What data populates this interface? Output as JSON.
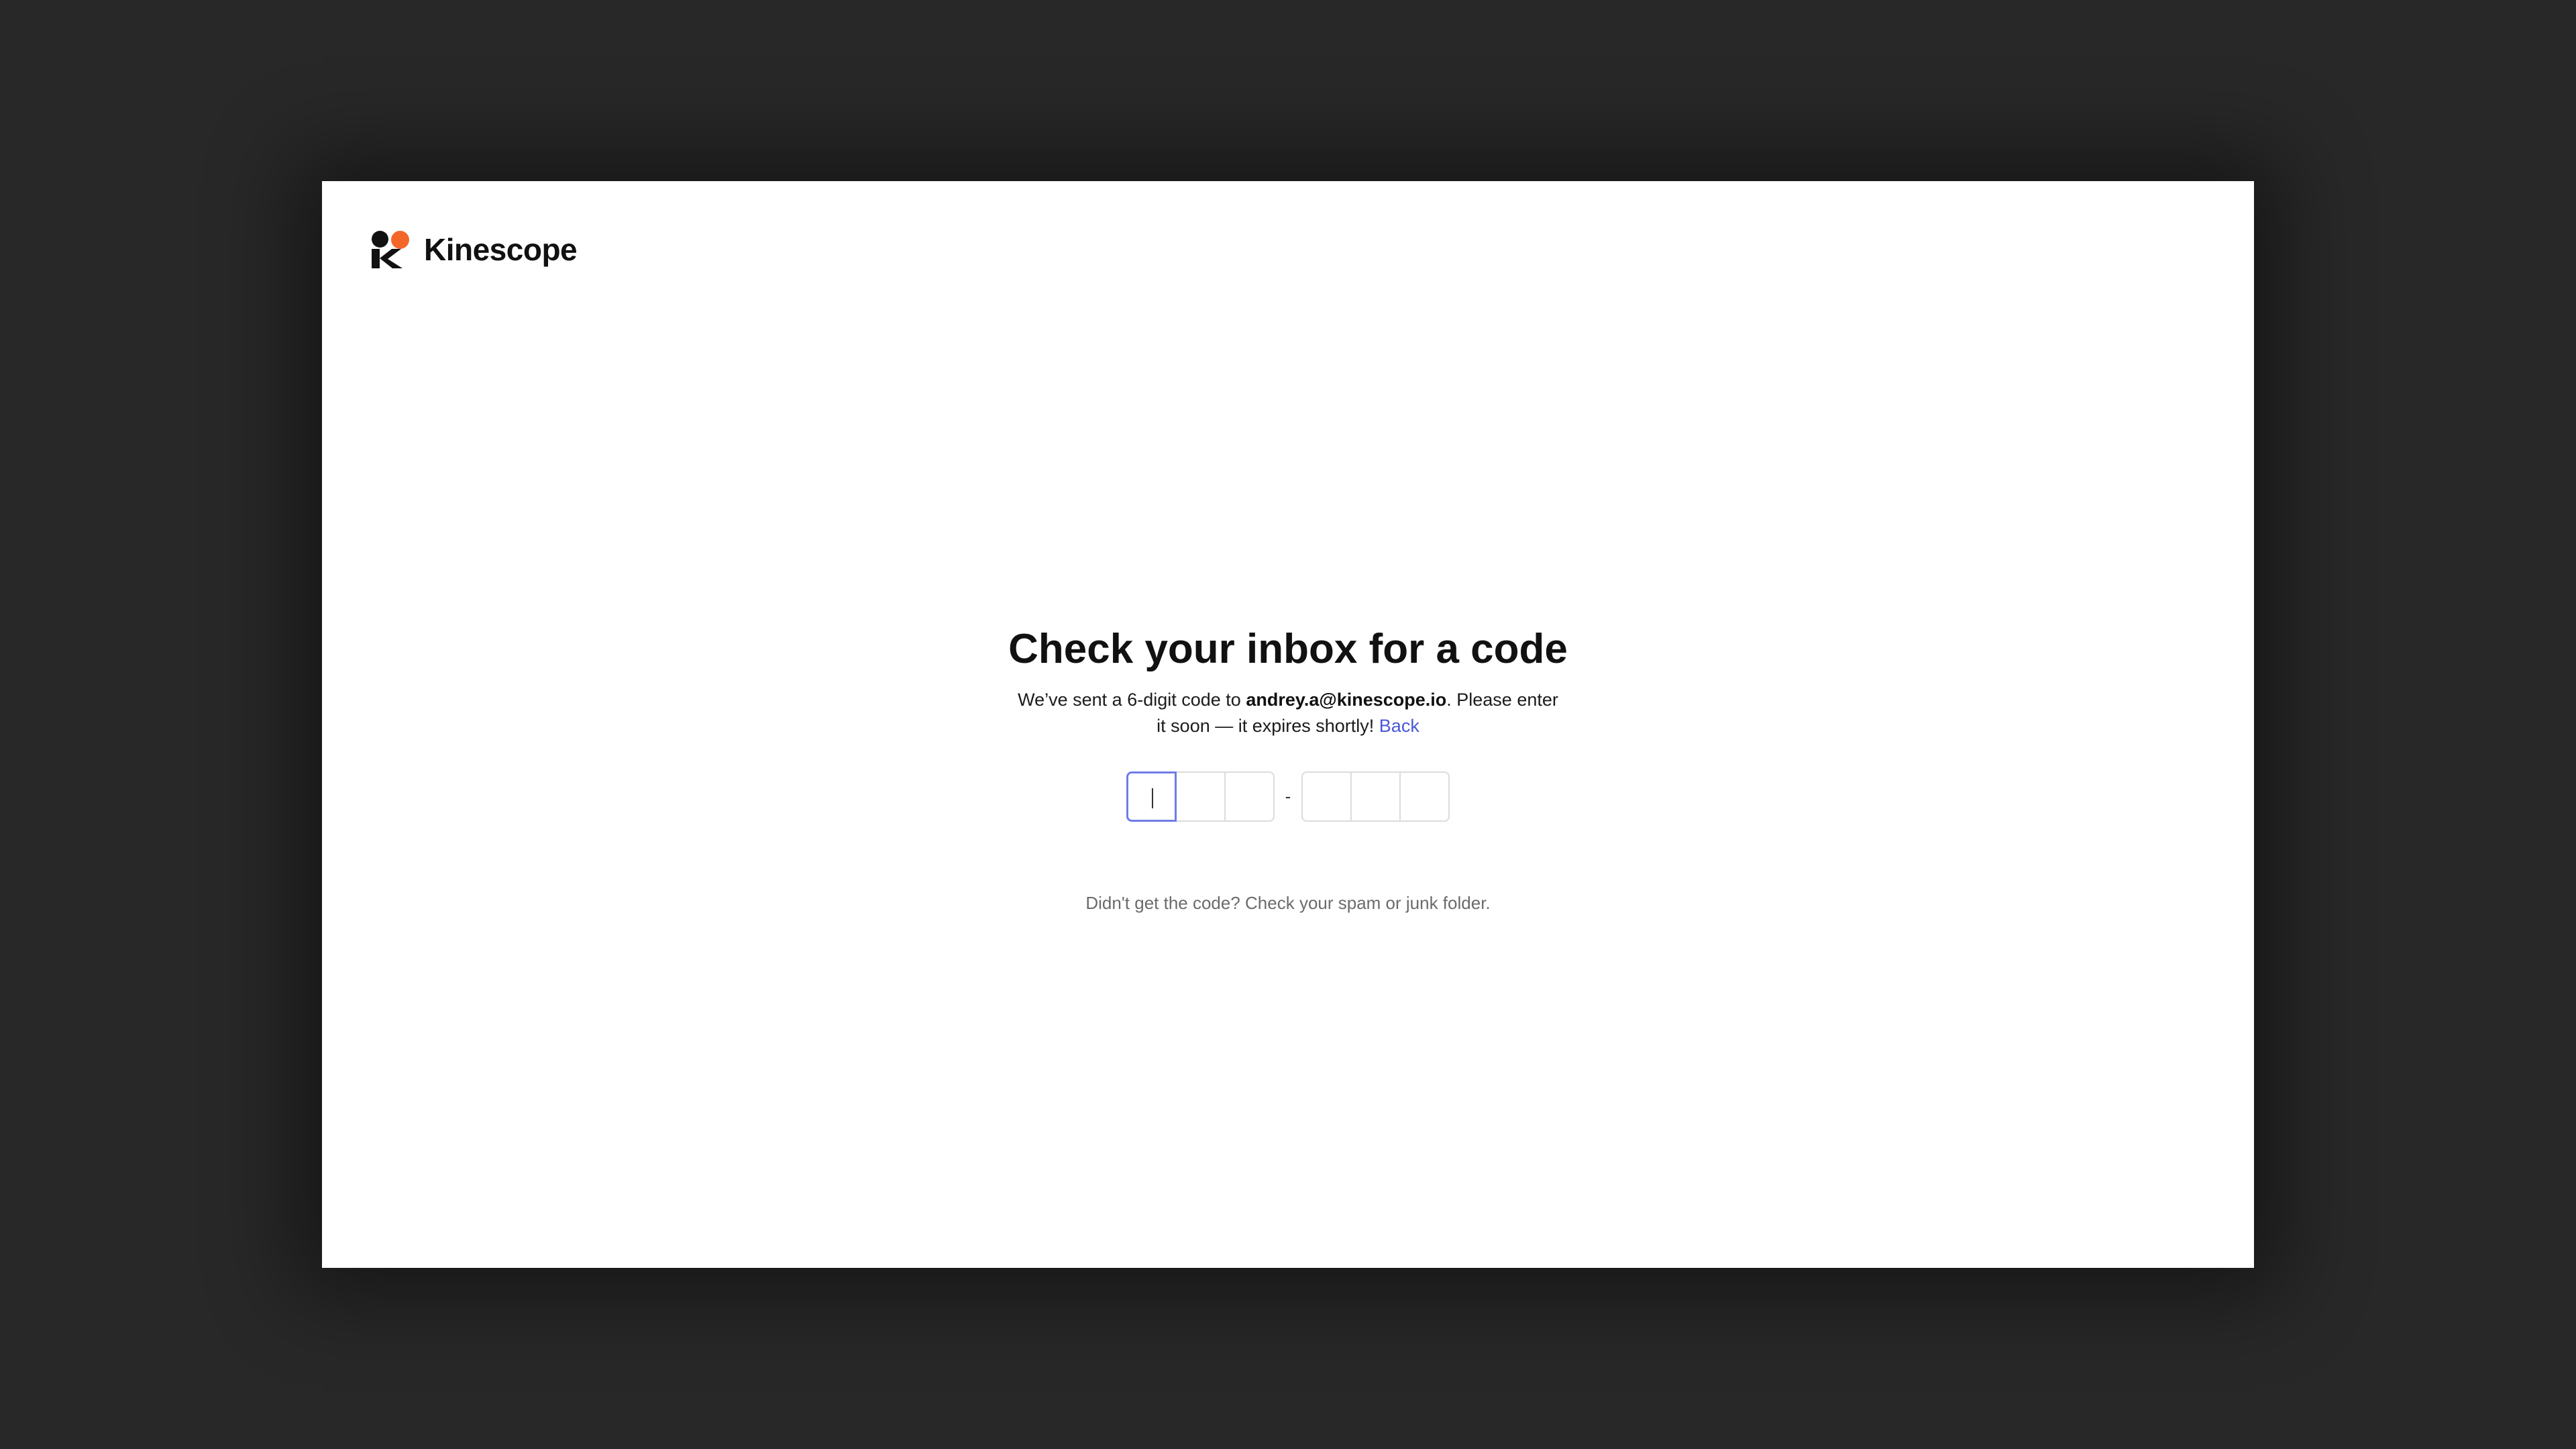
{
  "brand": {
    "name": "Kinescope",
    "accent": "#f4672a"
  },
  "main": {
    "title": "Check your inbox for a code",
    "description_prefix": "We’ve sent a 6-digit code to ",
    "email": "andrey.a@kinescope.io",
    "description_suffix": ". Please enter it soon — it expires shortly! ",
    "back_label": "Back",
    "link_color": "#4b58d6",
    "code_separator": "-",
    "code_digits": [
      "",
      "",
      "",
      "",
      "",
      ""
    ],
    "help_text": "Didn't get the code? Check your spam or junk folder."
  }
}
